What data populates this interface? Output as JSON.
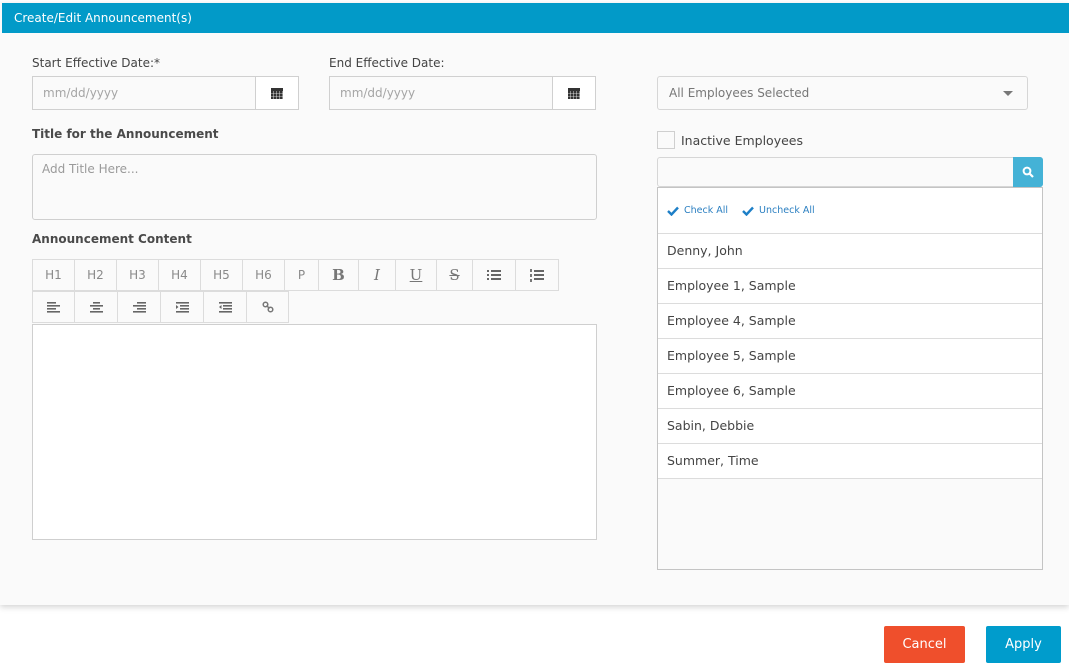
{
  "header": {
    "title": "Create/Edit Announcement(s)"
  },
  "start_date": {
    "label": "Start Effective Date:*",
    "placeholder": "mm/dd/yyyy",
    "value": "",
    "icon": "calendar-icon"
  },
  "end_date": {
    "label": "End Effective Date:",
    "placeholder": "mm/dd/yyyy",
    "value": "",
    "icon": "calendar-icon"
  },
  "title_field": {
    "label": "Title for the Announcement",
    "placeholder": "Add Title Here...",
    "value": ""
  },
  "content": {
    "label": "Announcement Content",
    "toolbar_row1": [
      {
        "label": "H1",
        "name": "heading-1-button"
      },
      {
        "label": "H2",
        "name": "heading-2-button"
      },
      {
        "label": "H3",
        "name": "heading-3-button"
      },
      {
        "label": "H4",
        "name": "heading-4-button"
      },
      {
        "label": "H5",
        "name": "heading-5-button"
      },
      {
        "label": "H6",
        "name": "heading-6-button"
      },
      {
        "label": "P",
        "name": "paragraph-button"
      },
      {
        "label": "B",
        "name": "bold-button"
      },
      {
        "label": "I",
        "name": "italic-button"
      },
      {
        "label": "U",
        "name": "underline-button"
      },
      {
        "label": "S",
        "name": "strikethrough-button"
      },
      {
        "icon": "bullet-list-icon",
        "name": "bullet-list-button"
      },
      {
        "icon": "numbered-list-icon",
        "name": "numbered-list-button"
      }
    ],
    "toolbar_row2": [
      {
        "icon": "align-left-icon",
        "name": "align-left-button"
      },
      {
        "icon": "align-center-icon",
        "name": "align-center-button"
      },
      {
        "icon": "align-right-icon",
        "name": "align-right-button"
      },
      {
        "icon": "indent-icon",
        "name": "indent-button"
      },
      {
        "icon": "outdent-icon",
        "name": "outdent-button"
      },
      {
        "icon": "link-icon",
        "name": "link-button"
      }
    ]
  },
  "employees": {
    "select_value": "All Employees Selected",
    "inactive_label": "Inactive Employees",
    "inactive_checked": false,
    "search_value": "",
    "check_all": "Check All",
    "uncheck_all": "Uncheck All",
    "items": [
      "Denny, John",
      "Employee 1, Sample",
      "Employee 4, Sample",
      "Employee 5, Sample",
      "Employee 6, Sample",
      "Sabin, Debbie",
      "Summer, Time"
    ]
  },
  "footer": {
    "cancel": "Cancel",
    "apply": "Apply"
  },
  "colors": {
    "header": "#029ac8",
    "cancel": "#ef4f2c",
    "apply": "#009ccc",
    "link": "#2b7fc1"
  }
}
